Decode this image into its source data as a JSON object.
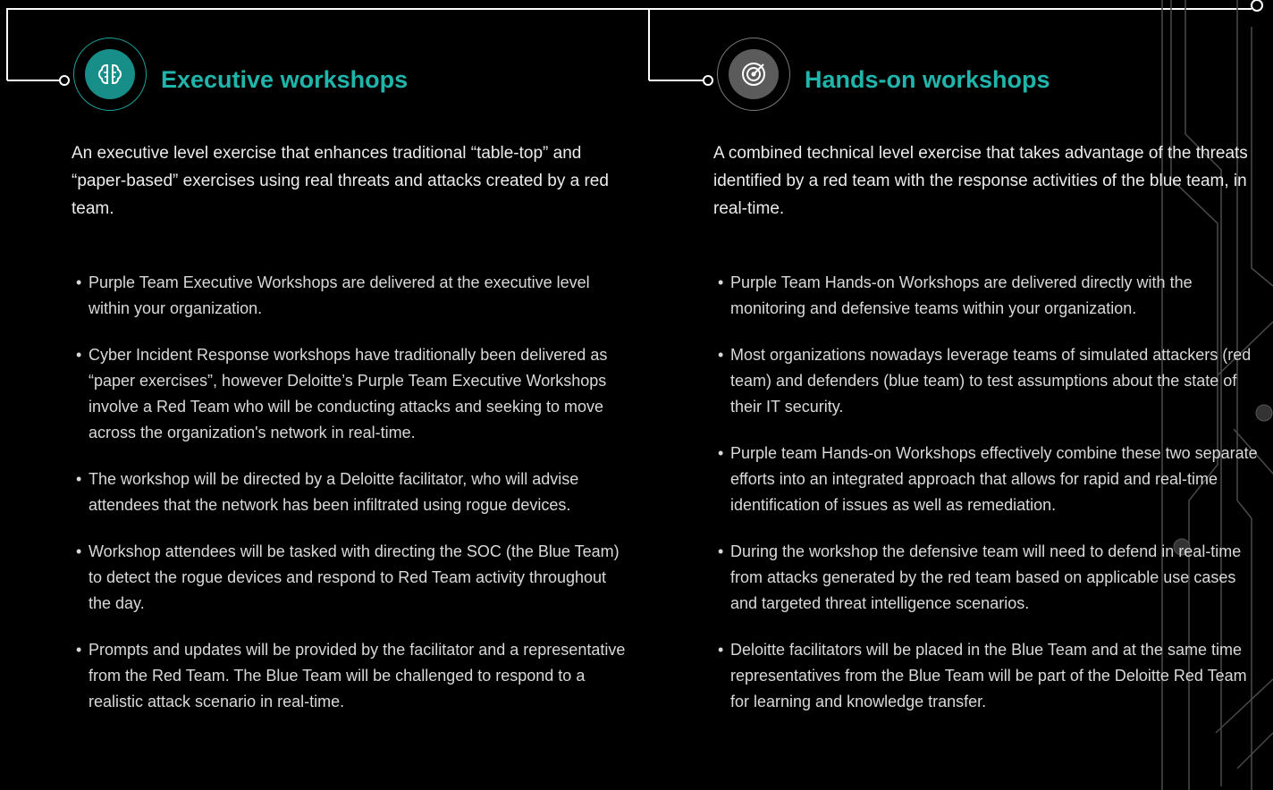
{
  "sections": [
    {
      "icon": "brain-icon",
      "title": "Executive workshops",
      "intro": "An executive level exercise that enhances traditional “table-top” and “paper-based” exercises using real threats and attacks created by a red team.",
      "bullets": [
        "Purple Team Executive Workshops are delivered at the executive level within your organization.",
        "Cyber Incident Response workshops have traditionally been delivered as “paper exercises”, however Deloitte’s Purple Team Executive Workshops involve a Red Team who will be conducting attacks and seeking to move across the organization's network in real-time.",
        "The workshop will be directed by a Deloitte facilitator, who will advise attendees that the network has been infiltrated using rogue devices.",
        "Workshop attendees will be tasked with directing the SOC (the Blue Team) to detect the rogue devices and respond to Red Team activity throughout the day.",
        "Prompts and updates will be provided by the facilitator and a representative from the Red Team. The Blue Team will be challenged to respond to a realistic attack scenario in real-time."
      ]
    },
    {
      "icon": "radar-target-icon",
      "title": "Hands-on workshops",
      "intro": "A combined technical level exercise that takes advantage of the threats identified by a red team with the response activities of the blue team, in real-time.",
      "bullets": [
        "Purple Team Hands-on Workshops are delivered directly with the monitoring and defensive teams within your organization.",
        "Most organizations nowadays leverage teams of simulated attackers (red team) and defenders (blue team) to test assumptions about the state of their IT security.",
        "Purple team Hands-on Workshops effectively combine these two separate efforts into an integrated approach that allows for rapid and real-time identification of issues as well as remediation.",
        "During the workshop the defensive team will need to defend in real-time from attacks generated by the red team based on applicable use cases and targeted threat intelligence scenarios.",
        "Deloitte facilitators will be placed in the Blue Team and at the same time representatives from the Blue Team will be part of the Deloitte Red Team for learning and knowledge transfer."
      ]
    }
  ],
  "bullet_glyph": "•",
  "colors": {
    "accent": "#1fb5ab",
    "background": "#000000",
    "text": "#e8e8e8",
    "line": "#ffffff"
  }
}
